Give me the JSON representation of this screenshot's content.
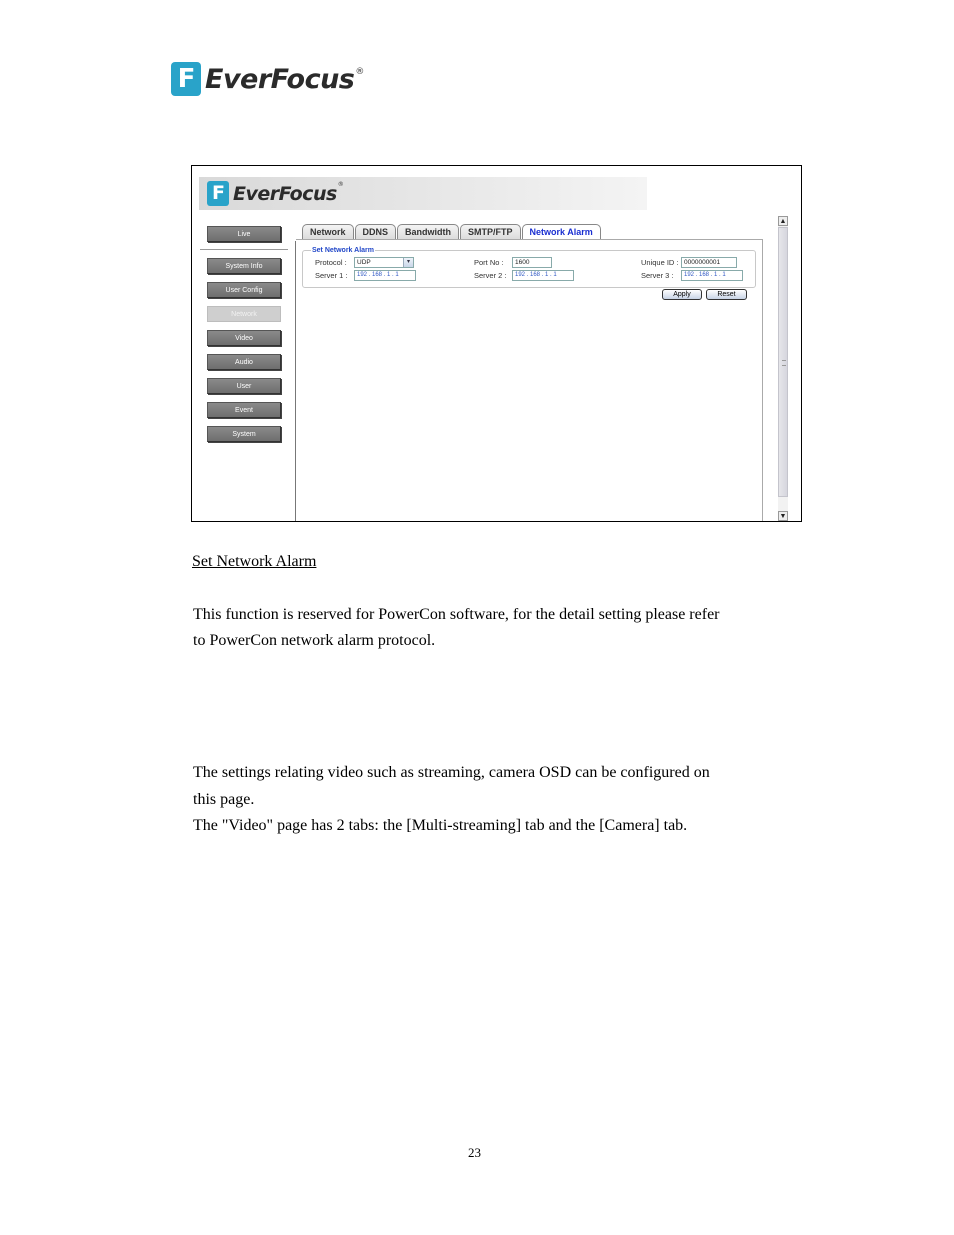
{
  "page_logo": {
    "mark": "F",
    "text": "EverFocus",
    "registered": "®"
  },
  "screenshot": {
    "banner": {
      "mark": "F",
      "text": "EverFocus",
      "registered": "®"
    },
    "sidebar": {
      "items": [
        {
          "label": "Live",
          "active": false
        },
        {
          "label": "System Info",
          "active": false
        },
        {
          "label": "User Config",
          "active": false
        },
        {
          "label": "Network",
          "active": true
        },
        {
          "label": "Video",
          "active": false
        },
        {
          "label": "Audio",
          "active": false
        },
        {
          "label": "User",
          "active": false
        },
        {
          "label": "Event",
          "active": false
        },
        {
          "label": "System",
          "active": false
        }
      ]
    },
    "tabs": [
      {
        "label": "Network",
        "active": false
      },
      {
        "label": "DDNS",
        "active": false
      },
      {
        "label": "Bandwidth",
        "active": false
      },
      {
        "label": "SMTP/FTP",
        "active": false
      },
      {
        "label": "Network Alarm",
        "active": true
      }
    ],
    "form": {
      "legend": "Set Network Alarm",
      "protocol_label": "Protocol :",
      "protocol_value": "UDP",
      "port_label": "Port No :",
      "port_value": "1600",
      "unique_id_label": "Unique ID :",
      "unique_id_value": "0000000001",
      "server1_label": "Server 1 :",
      "server1_value": "192 . 168 .  1  .  1",
      "server2_label": "Server 2 :",
      "server2_value": "192 . 168 .  1  .  1",
      "server3_label": "Server 3 :",
      "server3_value": "192 . 168 .  1  .  1",
      "apply_label": "Apply",
      "reset_label": "Reset"
    },
    "scrollbar": {
      "up": "▲",
      "down": "▼"
    }
  },
  "document": {
    "section_title": "Set Network Alarm",
    "para1_line1": "This function is reserved for PowerCon software, for the detail setting please refer",
    "para1_line2": "to PowerCon network alarm protocol.",
    "para2_line1": "The settings relating video such as streaming, camera OSD can be configured on",
    "para2_line2": "this page.",
    "para2_line3": "The \"Video\" page has 2 tabs: the [Multi-streaming] tab and the [Camera] tab.",
    "page_number": "23"
  }
}
